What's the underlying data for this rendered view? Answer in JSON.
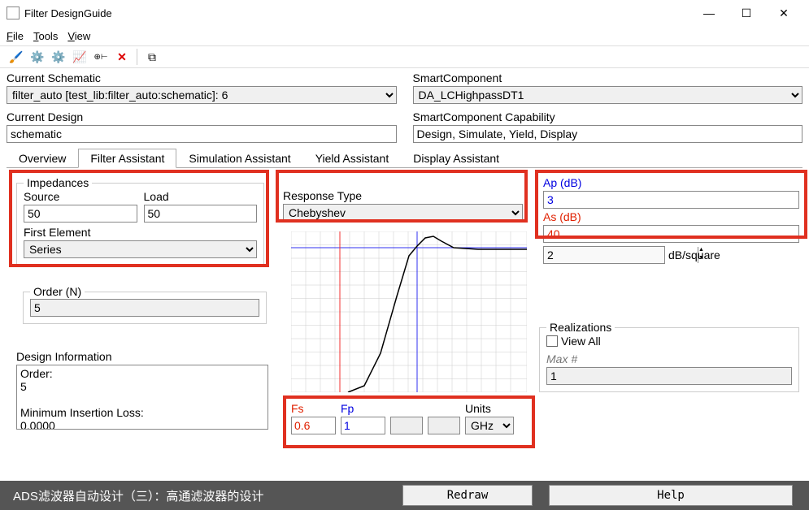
{
  "window": {
    "title": "Filter DesignGuide"
  },
  "menu": {
    "file": "File",
    "tools": "Tools",
    "view": "View"
  },
  "schematic": {
    "label": "Current Schematic",
    "value": "filter_auto [test_lib:filter_auto:schematic]: 6"
  },
  "smartcomponent": {
    "label": "SmartComponent",
    "value": "DA_LCHighpassDT1"
  },
  "current_design": {
    "label": "Current Design",
    "value": "schematic"
  },
  "capability": {
    "label": "SmartComponent Capability",
    "value": "Design, Simulate, Yield, Display"
  },
  "tabs": {
    "overview": "Overview",
    "filter": "Filter Assistant",
    "sim": "Simulation Assistant",
    "yield": "Yield Assistant",
    "display": "Display Assistant"
  },
  "impedances": {
    "legend": "Impedances",
    "source_label": "Source",
    "source": "50",
    "load_label": "Load",
    "load": "50",
    "first_elem_label": "First Element",
    "first_elem": "Series"
  },
  "order": {
    "legend": "Order (N)",
    "value": "5"
  },
  "design_info": {
    "label": "Design Information",
    "text": "Order:\n5\n\nMinimum Insertion Loss:\n0.0000"
  },
  "response": {
    "label": "Response Type",
    "value": "Chebyshev"
  },
  "ap": {
    "label": "Ap (dB)",
    "value": "3"
  },
  "as": {
    "label": "As (dB)",
    "value": "40"
  },
  "dbsq": {
    "value": "2",
    "unit": "dB/square"
  },
  "freq": {
    "fs_label": "Fs",
    "fs": "0.6",
    "fp_label": "Fp",
    "fp": "1",
    "units_label": "Units",
    "units": "GHz"
  },
  "realizations": {
    "legend": "Realizations",
    "viewall": "View All",
    "max_label": "Max #",
    "max": "1"
  },
  "buttons": {
    "redraw": "Redraw",
    "help": "Help"
  },
  "caption": "ADS滤波器自动设计（三）：高通滤波器的设计",
  "chart_data": {
    "type": "line",
    "xlabel": "",
    "ylabel": "",
    "xlim": [
      0,
      2.0
    ],
    "markers": {
      "fs": 0.6,
      "fp": 1.0
    },
    "series": [
      {
        "name": "response",
        "points": "approximate highpass filter response curve rising steeply near Fp=1, small overshoot, flattening after"
      }
    ]
  }
}
